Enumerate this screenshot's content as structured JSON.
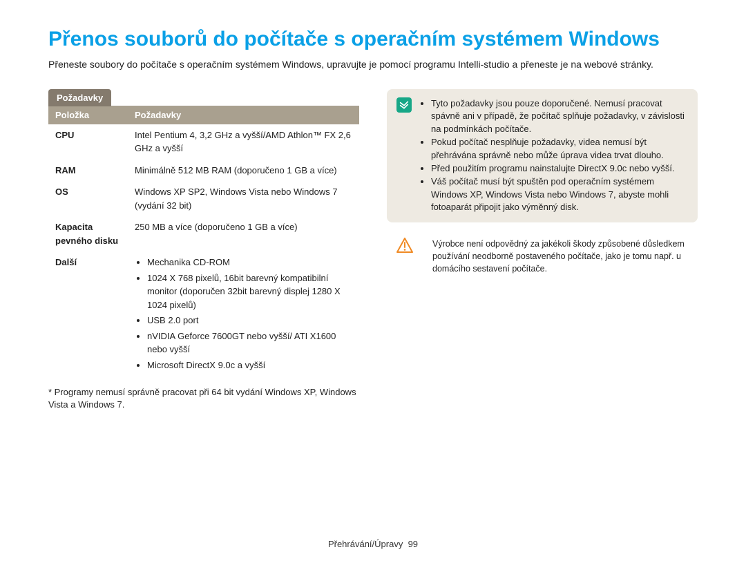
{
  "title": "Přenos souborů do počítače s operačním systémem Windows",
  "intro": "Přeneste soubory do počítače s operačním systémem Windows, upravujte je pomocí programu Intelli-studio a přeneste je na webové stránky.",
  "sectionLabel": "Požadavky",
  "table": {
    "header": {
      "item": "Položka",
      "req": "Požadavky"
    },
    "rows": {
      "cpu": {
        "label": "CPU",
        "val": "Intel Pentium 4, 3,2 GHz a vyšší/AMD Athlon™ FX 2,6 GHz a vyšší"
      },
      "ram": {
        "label": "RAM",
        "val": "Minimálně 512 MB RAM (doporučeno 1 GB a více)"
      },
      "os": {
        "label": "OS",
        "val": "Windows XP SP2, Windows Vista nebo Windows 7 (vydání 32 bit)"
      },
      "disk": {
        "label": "Kapacita pevného disku",
        "val": "250 MB a více (doporučeno 1 GB a více)"
      },
      "othersLabel": "Další",
      "others": {
        "i1": "Mechanika CD-ROM",
        "i2": "1024 X 768 pixelů, 16bit barevný kompatibilní monitor (doporučen 32bit barevný displej 1280 X 1024 pixelů)",
        "i3": "USB 2.0 port",
        "i4": "nVIDIA Geforce 7600GT nebo vyšší/ ATI X1600 nebo vyšší",
        "i5": "Microsoft DirectX 9.0c a vyšší"
      }
    }
  },
  "footnote": "* Programy nemusí správně pracovat při 64 bit vydání Windows XP, Windows Vista a Windows 7.",
  "note": {
    "n1": "Tyto požadavky jsou pouze doporučené. Nemusí pracovat spávně ani v případě, že počítač splňuje požadavky, v závislosti na podmínkách počítače.",
    "n2": "Pokud počítač nesplňuje požadavky, videa nemusí být přehrávána správně nebo může úprava videa trvat dlouho.",
    "n3": "Před použitím programu nainstalujte DirectX 9.0c nebo vyšší.",
    "n4": "Váš počítač musí být spuštěn pod operačním systémem Windows XP, Windows Vista nebo Windows 7, abyste mohli fotoaparát připojit jako výměnný disk."
  },
  "warning": "Výrobce není odpovědný za jakékoli škody způsobené důsledkem používání neodborně postaveného počítače, jako je tomu např. u domácího sestavení počítače.",
  "footer": {
    "section": "Přehrávání/Úpravy",
    "page": "99"
  }
}
